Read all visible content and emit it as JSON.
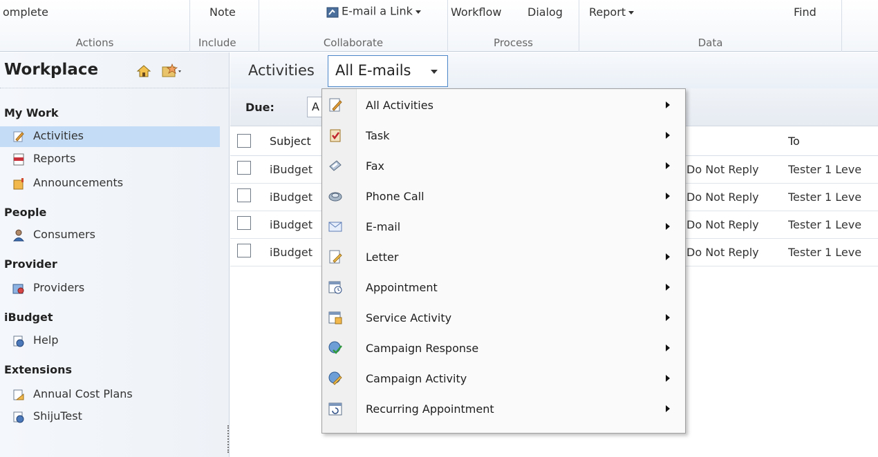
{
  "ribbon": {
    "groups": {
      "actions": {
        "button": "omplete",
        "label": "Actions"
      },
      "include": {
        "button": "Note",
        "label": "Include"
      },
      "collaborate": {
        "button": "E-mail a Link",
        "label": "Collaborate"
      },
      "process": {
        "button_workflow": "Workflow",
        "button_dialog": "Dialog",
        "label": "Process"
      },
      "data": {
        "button_report": "Report",
        "button_find": "Find",
        "label": "Data"
      }
    }
  },
  "leftnav": {
    "title": "Workplace",
    "sections": {
      "mywork": "My Work",
      "people": "People",
      "provider": "Provider",
      "ibudget": "iBudget",
      "extensions": "Extensions"
    },
    "items": {
      "activities": "Activities",
      "reports": "Reports",
      "announcements": "Announcements",
      "consumers": "Consumers",
      "providers": "Providers",
      "help": "Help",
      "annual_cost_plans": "Annual Cost Plans",
      "shijutest": "ShijuTest"
    }
  },
  "main": {
    "view_label": "Activities",
    "view_selected": "All E-mails",
    "filter": {
      "due_label": "Due:",
      "due_value": "A"
    },
    "grid": {
      "columns": {
        "subject": "Subject",
        "to": "To"
      },
      "rows": [
        {
          "subject": "iBudget",
          "from": "Do Not Reply",
          "to": "Tester 1 Leve"
        },
        {
          "subject": "iBudget",
          "from": "Do Not Reply",
          "to": "Tester 1 Leve"
        },
        {
          "subject": "iBudget",
          "from": "Do Not Reply",
          "to": "Tester 1 Leve"
        },
        {
          "subject": "iBudget",
          "from": "Do Not Reply",
          "to": "Tester 1 Leve"
        }
      ]
    }
  },
  "menu": {
    "items": [
      {
        "label": "All Activities",
        "icon": "notepad-pencil-icon"
      },
      {
        "label": "Task",
        "icon": "clipboard-check-icon"
      },
      {
        "label": "Fax",
        "icon": "fax-icon"
      },
      {
        "label": "Phone Call",
        "icon": "phone-icon"
      },
      {
        "label": "E-mail",
        "icon": "envelope-icon"
      },
      {
        "label": "Letter",
        "icon": "letter-pencil-icon"
      },
      {
        "label": "Appointment",
        "icon": "calendar-clock-icon"
      },
      {
        "label": "Service Activity",
        "icon": "calendar-tools-icon"
      },
      {
        "label": "Campaign Response",
        "icon": "globe-check-icon"
      },
      {
        "label": "Campaign Activity",
        "icon": "globe-pencil-icon"
      },
      {
        "label": "Recurring Appointment",
        "icon": "calendar-recurring-icon"
      }
    ]
  },
  "colors": {
    "selected_nav": "#c4dcf5",
    "view_select_border": "#4b87c8",
    "menu_gutter": "#f0f0f0"
  }
}
